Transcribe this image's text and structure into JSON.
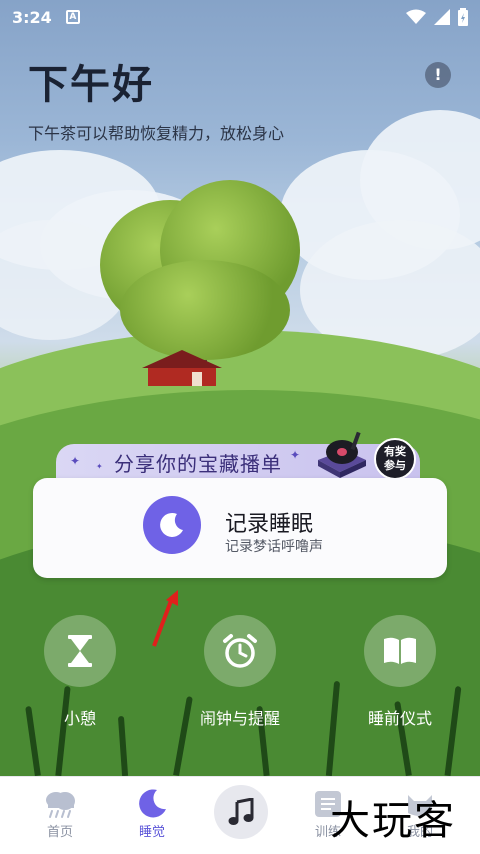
{
  "status": {
    "time": "3:24",
    "notify_letter": "A"
  },
  "greeting": {
    "title": "下午好",
    "subtitle": "下午茶可以帮助恢复精力，放松身心",
    "info_glyph": "!"
  },
  "banner": {
    "text": "分享你的宝藏播单",
    "badge_line1": "有奖",
    "badge_line2": "参与"
  },
  "record": {
    "title": "记录睡眠",
    "subtitle": "记录梦话呼噜声"
  },
  "features": [
    {
      "label": "小憩",
      "icon": "hourglass-icon"
    },
    {
      "label": "闹钟与提醒",
      "icon": "alarm-clock-icon"
    },
    {
      "label": "睡前仪式",
      "icon": "book-icon"
    }
  ],
  "nav": [
    {
      "label": "首页",
      "icon": "cloud-rain-icon"
    },
    {
      "label": "睡觉",
      "icon": "moon-icon",
      "active": true
    },
    {
      "label": "",
      "icon": "music-note-icon"
    },
    {
      "label": "训练",
      "icon": "list-icon"
    },
    {
      "label": "我的",
      "icon": "cat-icon"
    }
  ],
  "watermark": "大玩客",
  "colors": {
    "accent": "#6f62e6",
    "nav_active": "#5b55d8",
    "banner_text": "#3b2f7a"
  }
}
